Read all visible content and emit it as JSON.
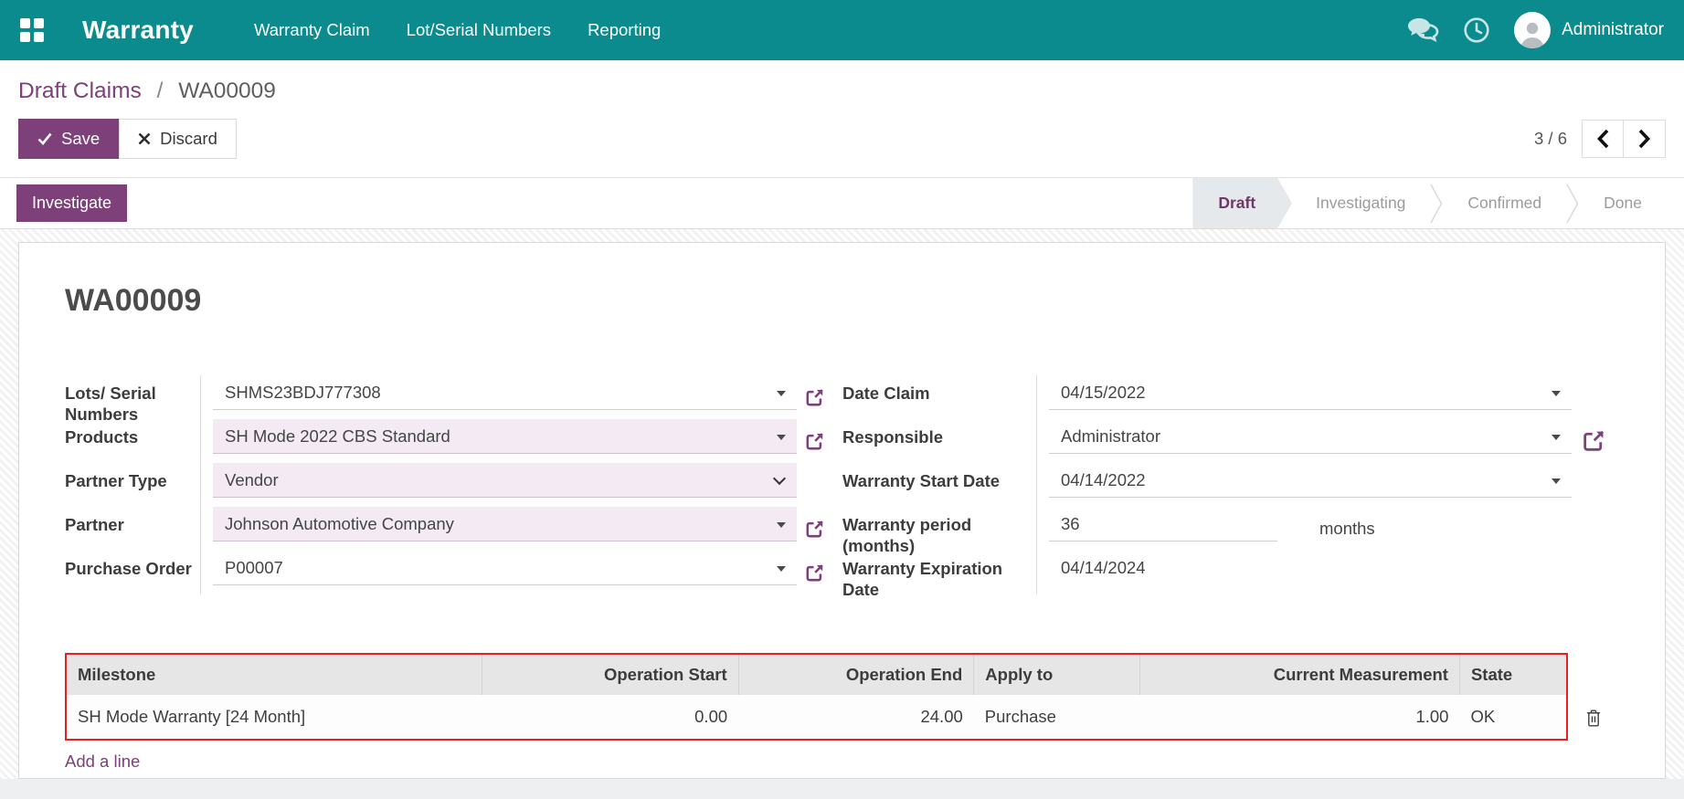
{
  "navbar": {
    "brand": "Warranty",
    "menu": [
      "Warranty Claim",
      "Lot/Serial Numbers",
      "Reporting"
    ],
    "user_name": "Administrator"
  },
  "breadcrumb": {
    "parent": "Draft Claims",
    "separator": "/",
    "current": "WA00009"
  },
  "control_panel": {
    "save_label": "Save",
    "discard_label": "Discard",
    "pager_value": "3 / 6"
  },
  "statusbar": {
    "action_button": "Investigate",
    "steps": [
      {
        "label": "Draft",
        "active": true
      },
      {
        "label": "Investigating",
        "active": false
      },
      {
        "label": "Confirmed",
        "active": false
      },
      {
        "label": "Done",
        "active": false
      }
    ]
  },
  "form": {
    "title": "WA00009",
    "left_fields": [
      {
        "label": "Lots/ Serial Numbers",
        "value": "SHMS23BDJ777308"
      },
      {
        "label": "Products",
        "value": "SH Mode 2022 CBS Standard"
      },
      {
        "label": "Partner Type",
        "value": "Vendor"
      },
      {
        "label": "Partner",
        "value": "Johnson Automotive Company"
      },
      {
        "label": "Purchase Order",
        "value": "P00007"
      }
    ],
    "right_fields": [
      {
        "label": "Date Claim",
        "value": "04/15/2022"
      },
      {
        "label": "Responsible",
        "value": "Administrator"
      },
      {
        "label": "Warranty Start Date",
        "value": "04/14/2022"
      },
      {
        "label": "Warranty period (months)",
        "value": "36",
        "suffix": "months"
      },
      {
        "label": "Warranty Expiration Date",
        "value": "04/14/2024"
      }
    ]
  },
  "milestones": {
    "columns": [
      "Milestone",
      "Operation Start",
      "Operation End",
      "Apply to",
      "Current Measurement",
      "State"
    ],
    "rows": [
      {
        "milestone": "SH Mode Warranty [24 Month]",
        "operation_start": "0.00",
        "operation_end": "24.00",
        "apply_to": "Purchase",
        "current_measurement": "1.00",
        "state": "OK"
      }
    ],
    "add_line_label": "Add a line"
  },
  "colors": {
    "navbar_teal": "#0b8b8d",
    "primary_purple": "#7d4079",
    "field_highlight": "#f3eaf4",
    "table_outline_red": "#e32222",
    "active_step_bg": "#e6e9ec"
  }
}
